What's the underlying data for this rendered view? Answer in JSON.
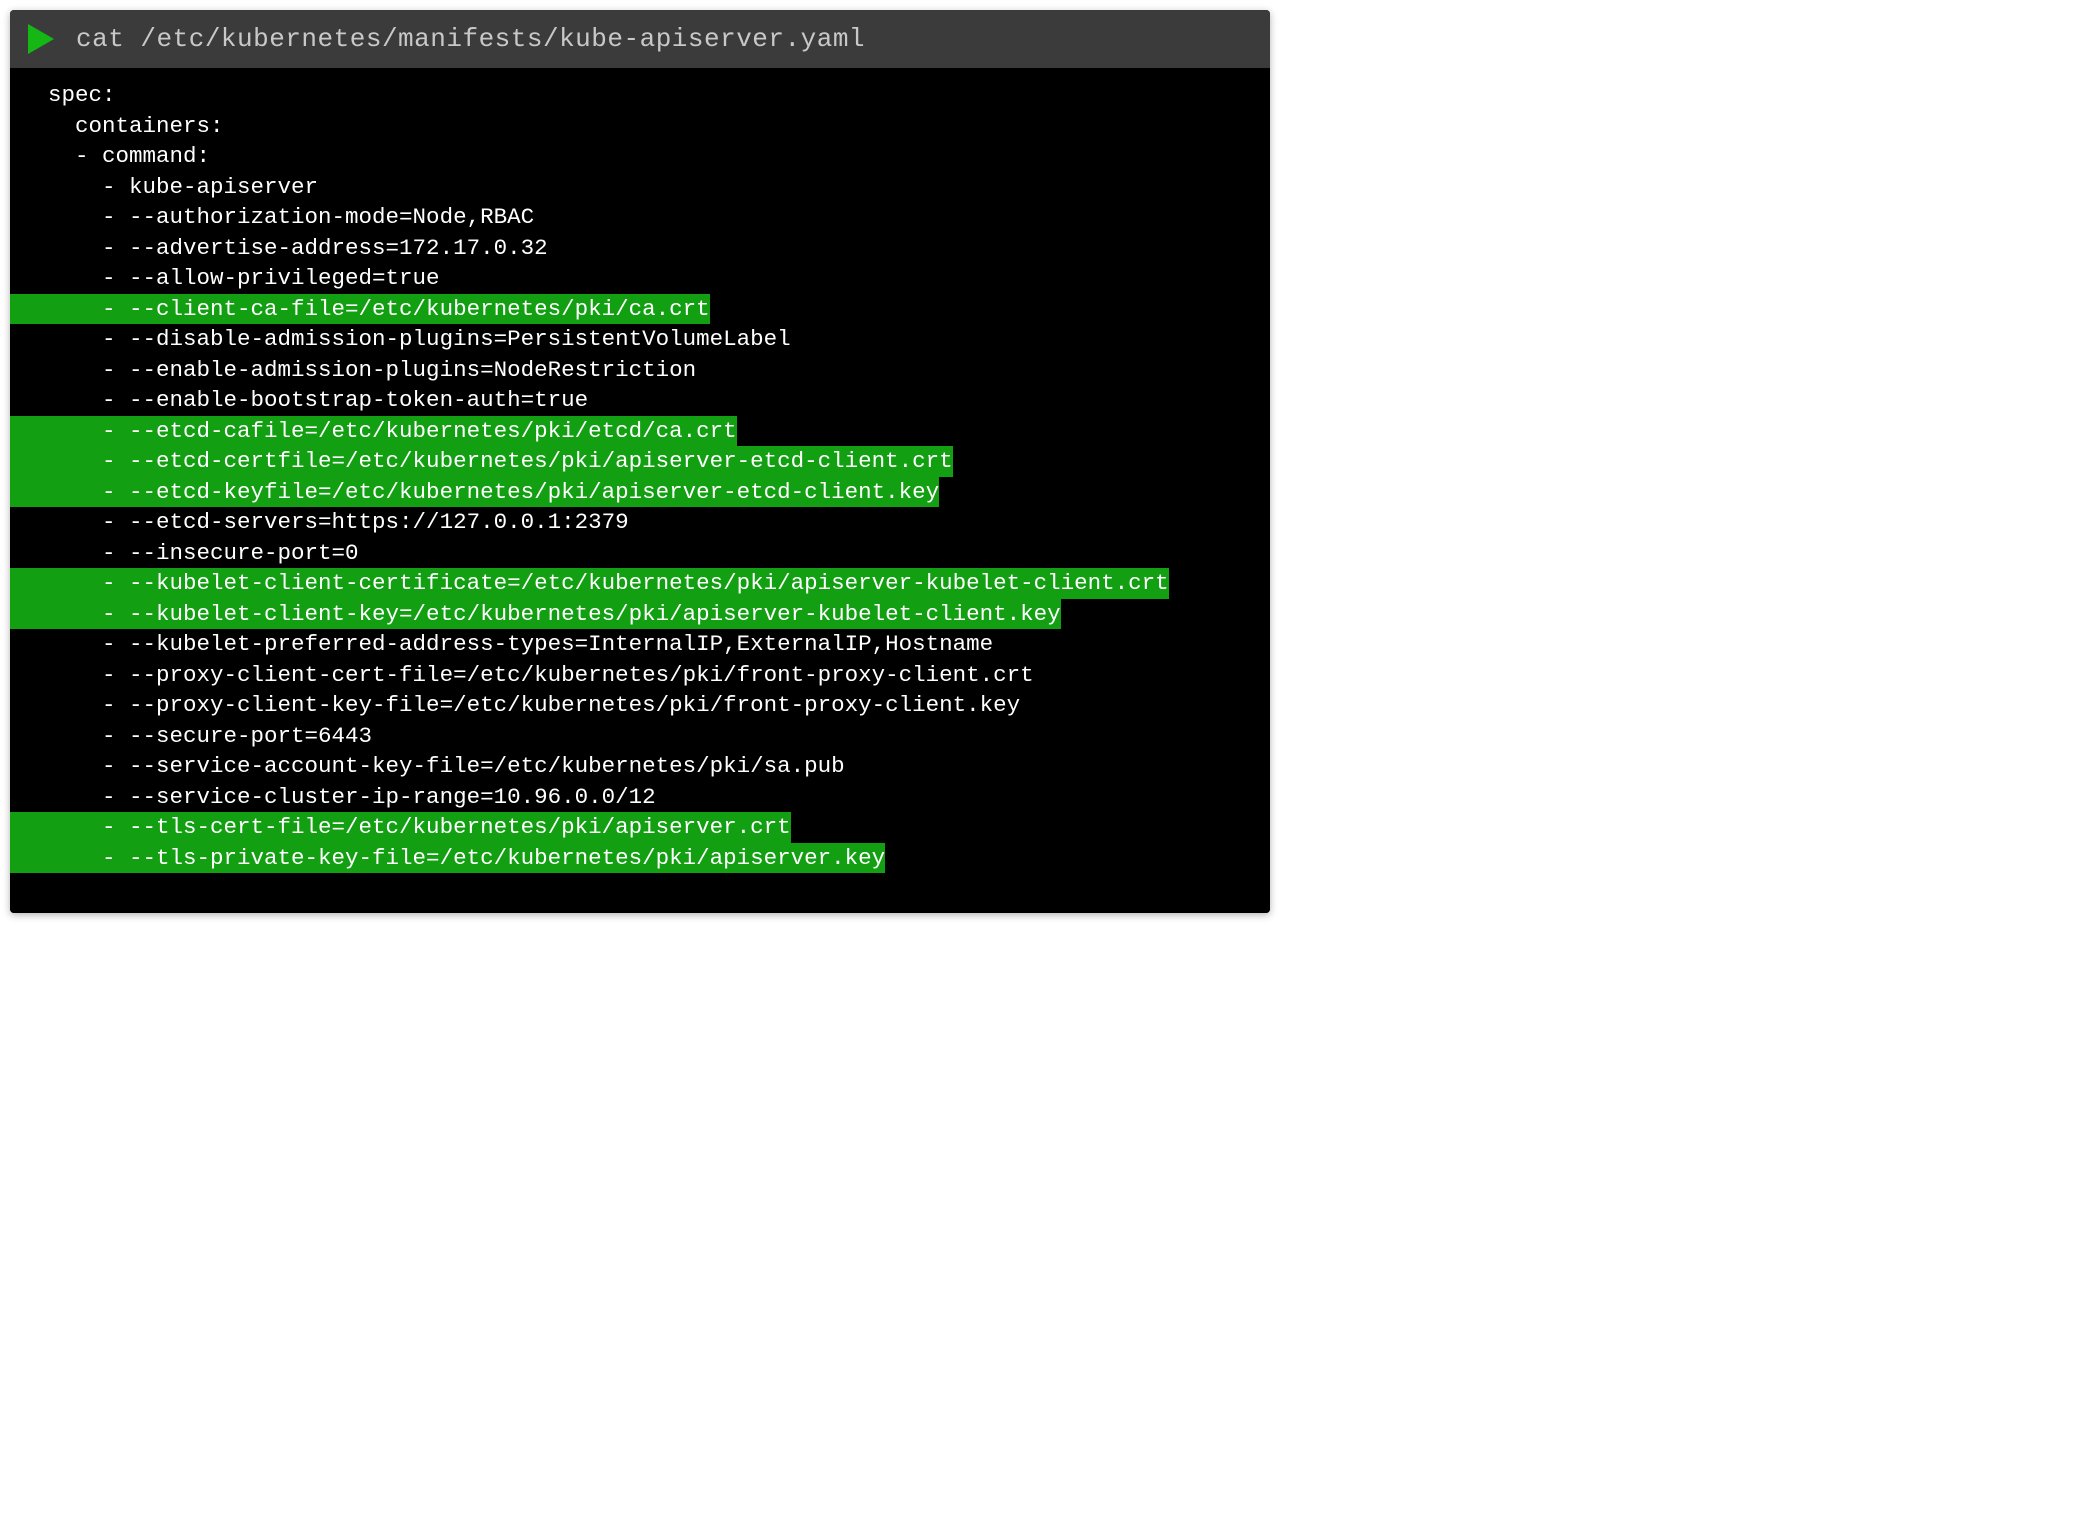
{
  "colors": {
    "highlight": "#12a012",
    "titlebar": "#3b3b3b",
    "terminal_bg": "#000000",
    "play_icon": "#15b715"
  },
  "command": "cat /etc/kubernetes/manifests/kube-apiserver.yaml",
  "lines": [
    {
      "text": "spec:",
      "indent": 0,
      "hl": false
    },
    {
      "text": "containers:",
      "indent": 1,
      "hl": false
    },
    {
      "text": "- command:",
      "indent": 1,
      "hl": false
    },
    {
      "text": "- kube-apiserver",
      "indent": 2,
      "hl": false
    },
    {
      "text": "- --authorization-mode=Node,RBAC",
      "indent": 2,
      "hl": false
    },
    {
      "text": "- --advertise-address=172.17.0.32",
      "indent": 2,
      "hl": false
    },
    {
      "text": "- --allow-privileged=true",
      "indent": 2,
      "hl": false
    },
    {
      "text": "- --client-ca-file=/etc/kubernetes/pki/ca.crt",
      "indent": 2,
      "hl": true
    },
    {
      "text": "- --disable-admission-plugins=PersistentVolumeLabel",
      "indent": 2,
      "hl": false
    },
    {
      "text": "- --enable-admission-plugins=NodeRestriction",
      "indent": 2,
      "hl": false
    },
    {
      "text": "- --enable-bootstrap-token-auth=true",
      "indent": 2,
      "hl": false
    },
    {
      "text": "- --etcd-cafile=/etc/kubernetes/pki/etcd/ca.crt",
      "indent": 2,
      "hl": true
    },
    {
      "text": "- --etcd-certfile=/etc/kubernetes/pki/apiserver-etcd-client.crt",
      "indent": 2,
      "hl": true
    },
    {
      "text": "- --etcd-keyfile=/etc/kubernetes/pki/apiserver-etcd-client.key",
      "indent": 2,
      "hl": true
    },
    {
      "text": "- --etcd-servers=https://127.0.0.1:2379",
      "indent": 2,
      "hl": false
    },
    {
      "text": "- --insecure-port=0",
      "indent": 2,
      "hl": false
    },
    {
      "text": "- --kubelet-client-certificate=/etc/kubernetes/pki/apiserver-kubelet-client.crt",
      "indent": 2,
      "hl": true
    },
    {
      "text": "- --kubelet-client-key=/etc/kubernetes/pki/apiserver-kubelet-client.key",
      "indent": 2,
      "hl": true
    },
    {
      "text": "- --kubelet-preferred-address-types=InternalIP,ExternalIP,Hostname",
      "indent": 2,
      "hl": false
    },
    {
      "text": "- --proxy-client-cert-file=/etc/kubernetes/pki/front-proxy-client.crt",
      "indent": 2,
      "hl": false
    },
    {
      "text": "- --proxy-client-key-file=/etc/kubernetes/pki/front-proxy-client.key",
      "indent": 2,
      "hl": false
    },
    {
      "text": "- --secure-port=6443",
      "indent": 2,
      "hl": false
    },
    {
      "text": "- --service-account-key-file=/etc/kubernetes/pki/sa.pub",
      "indent": 2,
      "hl": false
    },
    {
      "text": "- --service-cluster-ip-range=10.96.0.0/12",
      "indent": 2,
      "hl": false
    },
    {
      "text": "- --tls-cert-file=/etc/kubernetes/pki/apiserver.crt",
      "indent": 2,
      "hl": true
    },
    {
      "text": "- --tls-private-key-file=/etc/kubernetes/pki/apiserver.key",
      "indent": 2,
      "hl": true
    }
  ]
}
